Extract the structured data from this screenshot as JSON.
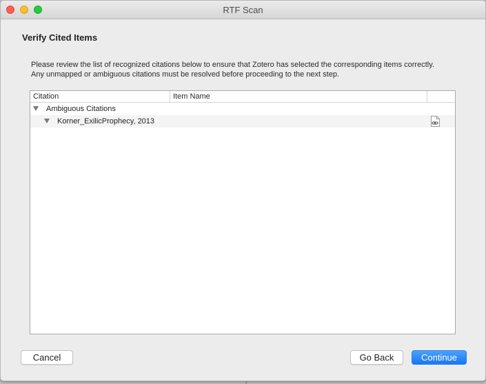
{
  "window": {
    "title": "RTF Scan"
  },
  "page": {
    "heading": "Verify Cited Items",
    "description": "Please review the list of recognized citations below to ensure that Zotero has selected the corresponding items correctly. Any unmapped or ambiguous citations must be resolved before proceeding to the next step."
  },
  "table": {
    "columns": [
      "Citation",
      "Item Name",
      ""
    ],
    "rows": [
      {
        "label": "Ambiguous Citations",
        "level": 0,
        "expanded": true
      },
      {
        "label": "Korner_ExilicProphecy, 2013",
        "level": 1,
        "expanded": true,
        "icon": "link-document-icon"
      }
    ]
  },
  "buttons": {
    "cancel": "Cancel",
    "back": "Go Back",
    "continue": "Continue"
  },
  "colors": {
    "accent": "#1977f2",
    "close": "#fe5f57",
    "minimize": "#febc2e",
    "zoom": "#28c840"
  }
}
